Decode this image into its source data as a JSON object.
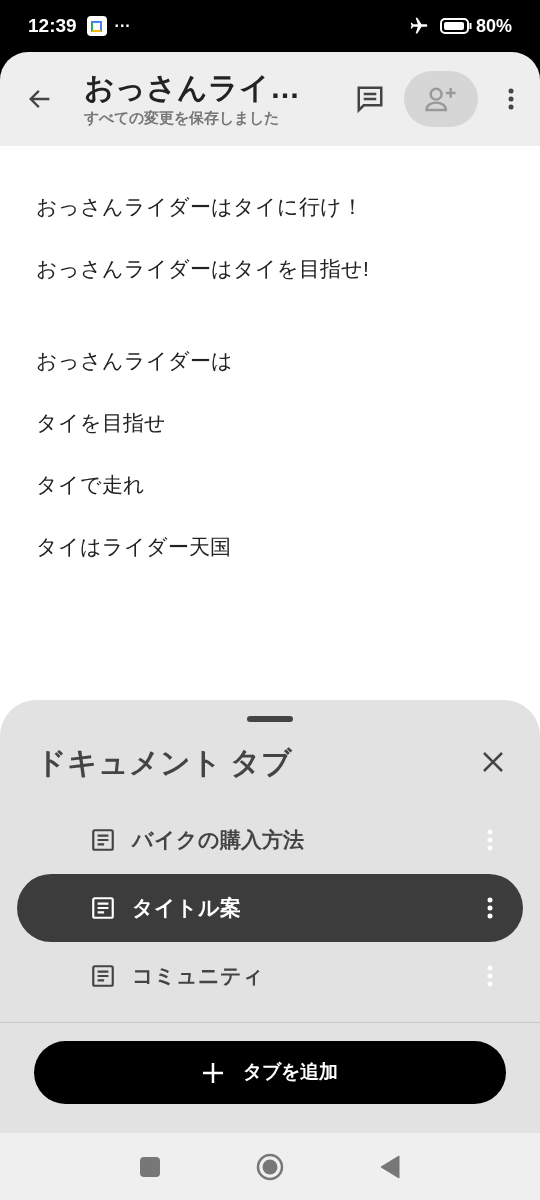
{
  "status_bar": {
    "time": "12:39",
    "more": "···",
    "battery": "80%"
  },
  "app_bar": {
    "title": "おっさんライ…",
    "subtitle": "すべての変更を保存しました"
  },
  "document": {
    "sections": [
      [
        "おっさんライダーはタイに行け！",
        "おっさんライダーはタイを目指せ!"
      ],
      [
        "おっさんライダーは",
        "タイを目指せ",
        "タイで走れ",
        "タイはライダー天国"
      ]
    ]
  },
  "sheet": {
    "title": "ドキュメント タブ",
    "tabs": [
      {
        "label": "バイクの購入方法",
        "selected": false
      },
      {
        "label": "タイトル案",
        "selected": true
      },
      {
        "label": "コミュニティ",
        "selected": false
      }
    ],
    "add_button": "タブを追加"
  }
}
